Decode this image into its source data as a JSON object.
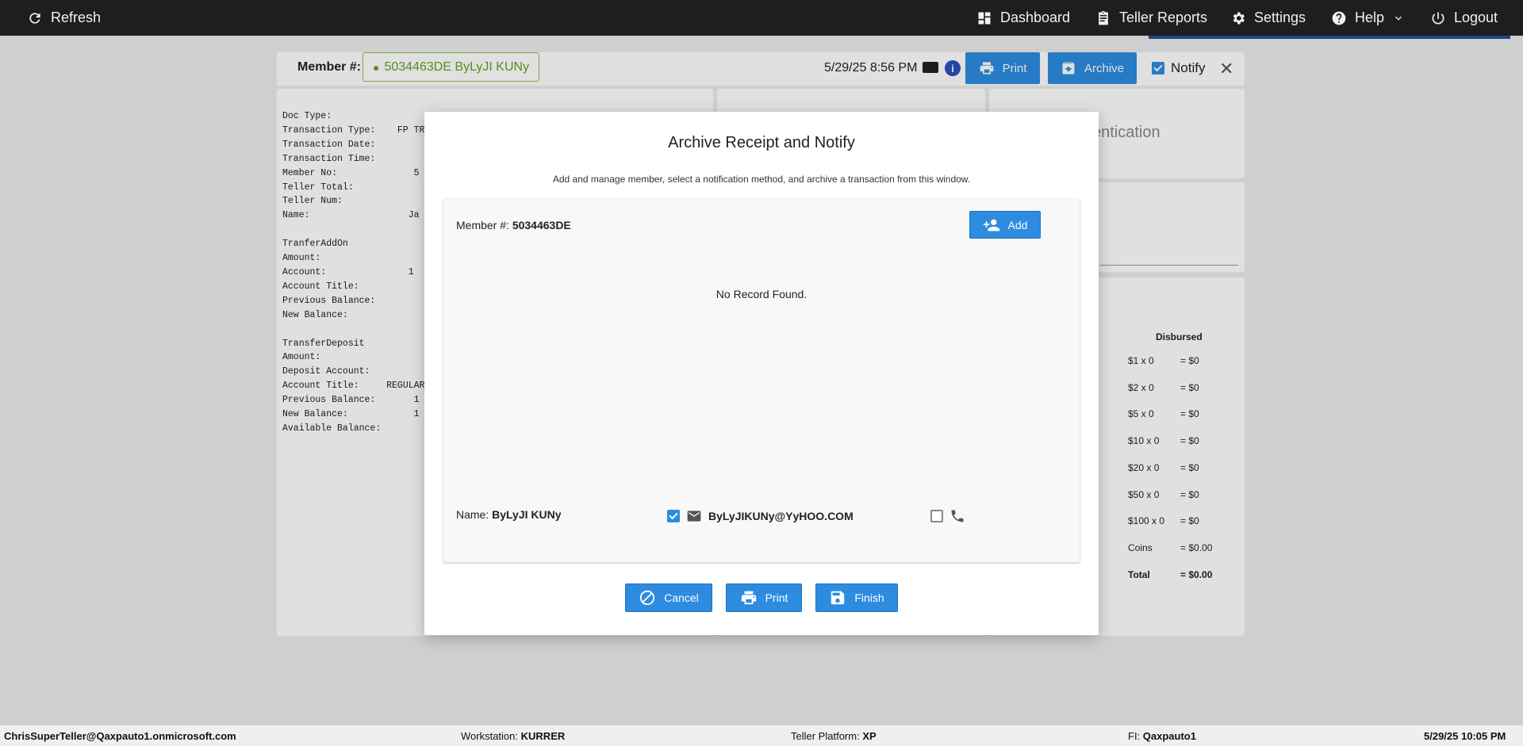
{
  "nav": {
    "refresh": "Refresh",
    "dashboard": "Dashboard",
    "teller_reports": "Teller Reports",
    "settings": "Settings",
    "help": "Help",
    "logout": "Logout"
  },
  "toolbar": {
    "member_label": "Member #:",
    "member_chip": "5034463DE ByLyJI KUNy",
    "datetime": "5/29/25 8:56 PM",
    "print": "Print",
    "archive": "Archive",
    "notify": "Notify",
    "notify_checked": true
  },
  "receipt": {
    "lines": [
      "Doc Type:",
      "Transaction Type:    FP TRA",
      "Transaction Date:",
      "Transaction Time:",
      "Member No:              5",
      "Teller Total:",
      "Teller Num:",
      "Name:                  Ja",
      "",
      "TranferAddOn",
      "Amount:",
      "Account:               1",
      "Account Title:",
      "Previous Balance:",
      "New Balance:",
      "",
      "TransferDeposit",
      "Amount:",
      "Deposit Account:",
      "Account Title:     REGULAR",
      "Previous Balance:       1",
      "New Balance:            1",
      "Available Balance:"
    ]
  },
  "right_panel": {
    "auth_text": "entication",
    "disbursed_header": "Disbursed",
    "rows": [
      {
        "denom": "$1 x 0",
        "value": "= $0"
      },
      {
        "denom": "$2 x 0",
        "value": "= $0"
      },
      {
        "denom": "$5 x 0",
        "value": "= $0"
      },
      {
        "denom": "$10 x 0",
        "value": "= $0"
      },
      {
        "denom": "$20 x 0",
        "value": "= $0"
      },
      {
        "denom": "$50 x 0",
        "value": "= $0"
      },
      {
        "denom": "$100 x 0",
        "value": "= $0"
      },
      {
        "denom": "Coins",
        "value": "= $0.00"
      },
      {
        "denom": "Total",
        "value": "= $0.00"
      }
    ]
  },
  "modal": {
    "title": "Archive Receipt and Notify",
    "subtitle": "Add and manage member, select a notification method, and archive a transaction from this window.",
    "member_label": "Member #:",
    "member_number": "5034463DE",
    "add": "Add",
    "no_record": "No Record Found.",
    "name_label": "Name:",
    "name_value": "ByLyJI KUNy",
    "email": "ByLyJIKUNy@YyHOO.COM",
    "email_checked": true,
    "phone_checked": false,
    "cancel": "Cancel",
    "print": "Print",
    "finish": "Finish"
  },
  "status": {
    "user": "ChrisSuperTeller@Qaxpauto1.onmicrosoft.com",
    "workstation_label": "Workstation:",
    "workstation": "KURRER",
    "platform_label": "Teller Platform:",
    "platform": "XP",
    "fi_label": "FI:",
    "fi": "Qaxpauto1",
    "datetime": "5/29/25 10:05 PM"
  },
  "colors": {
    "primary": "#2d8be0",
    "topbar": "#1e1e1e",
    "member_chip": "#6aa020"
  }
}
